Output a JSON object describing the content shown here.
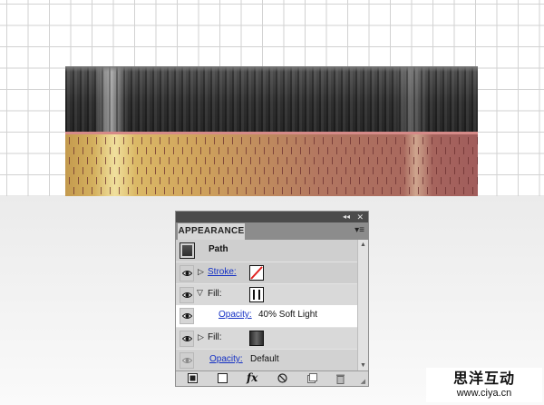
{
  "panel": {
    "title": "APPEARANCE",
    "collapse_glyph": "◂◂",
    "close_glyph": "✕",
    "menu_glyph": "▾≡",
    "rows": {
      "path": {
        "label": "Path"
      },
      "stroke": {
        "label": "Stroke:",
        "swatch": "none-swatch"
      },
      "fill1": {
        "label": "Fill:",
        "swatch": "white-black-stripes-swatch"
      },
      "opacity1": {
        "label": "Opacity:",
        "value": "40% Soft Light"
      },
      "fill2": {
        "label": "Fill:",
        "swatch": "dark-gradient-swatch"
      },
      "opacity2": {
        "label": "Opacity:",
        "value": "Default"
      }
    },
    "bottom_icons": [
      "add-stroke-icon",
      "add-fill-icon",
      "fx-icon",
      "clear-icon",
      "duplicate-icon",
      "delete-icon"
    ],
    "fx_label": "fx"
  },
  "watermark": {
    "cn": "思洋互动",
    "url": "www.ciya.cn"
  },
  "colors": {
    "link": "#1430c4",
    "panel_bg": "#d6d6d6",
    "dark_band": "#2f2f2f",
    "fill_gold": "#dfc06a",
    "fill_red": "#a15d5c"
  }
}
